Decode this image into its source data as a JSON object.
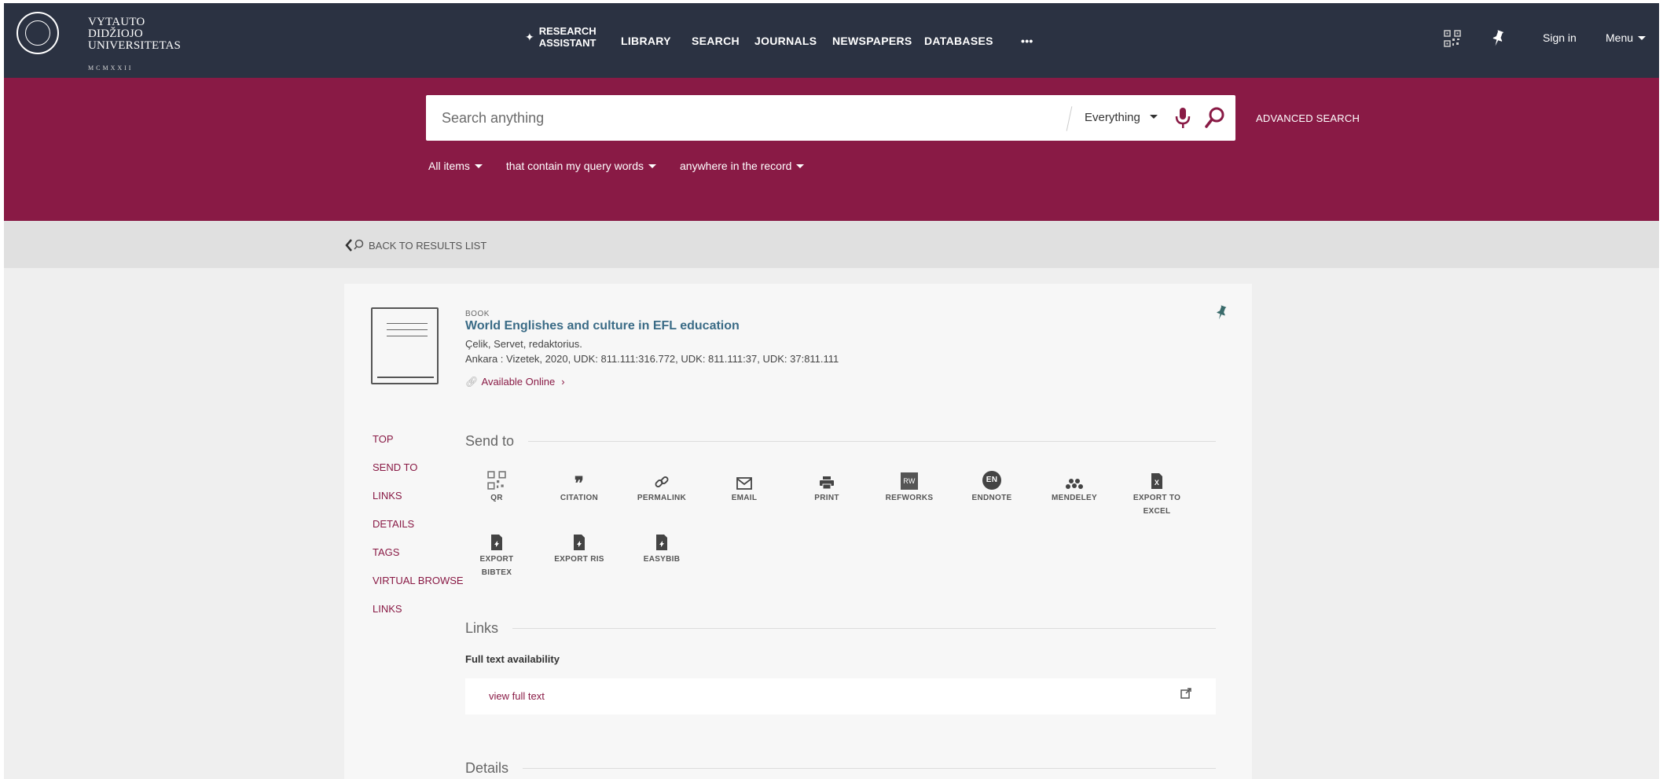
{
  "header": {
    "university_lines": [
      "VYTAUTO",
      "DIDŽIOJO",
      "UNIVERSITETAS"
    ],
    "founding_year": "MCMXXII",
    "research_assistant": [
      "RESEARCH",
      "ASSISTANT"
    ],
    "nav": [
      "LIBRARY",
      "SEARCH",
      "JOURNALS",
      "NEWSPAPERS",
      "DATABASES"
    ],
    "more": "•••",
    "sign_in": "Sign in",
    "menu": "Menu"
  },
  "search": {
    "placeholder": "Search anything",
    "scope": "Everything",
    "advanced": "ADVANCED SEARCH",
    "filters": [
      "All items",
      "that contain my query words",
      "anywhere in the record"
    ]
  },
  "back": {
    "label": "BACK TO RESULTS LIST"
  },
  "record": {
    "type": "BOOK",
    "title": "World Englishes and culture in EFL education",
    "author": "Çelik, Servet, redaktorius.",
    "publication": "Ankara : Vizetek, 2020, UDK: 811.111:316.772, UDK: 811.111:37, UDK: 37:811.111",
    "availability": "Available Online",
    "availability_arrow": "›"
  },
  "sidenav": [
    "TOP",
    "SEND TO",
    "LINKS",
    "DETAILS",
    "TAGS",
    "VIRTUAL BROWSE",
    "LINKS"
  ],
  "send_to": {
    "heading": "Send to",
    "actions": [
      {
        "label": "QR",
        "icon": "qr-icon"
      },
      {
        "label": "CITATION",
        "icon": "quote-icon"
      },
      {
        "label": "PERMALINK",
        "icon": "link-icon"
      },
      {
        "label": "EMAIL",
        "icon": "envelope-icon"
      },
      {
        "label": "PRINT",
        "icon": "printer-icon"
      },
      {
        "label": "REFWORKS",
        "icon": "refworks-icon",
        "badge": "RW"
      },
      {
        "label": "ENDNOTE",
        "icon": "endnote-icon",
        "badge": "EN"
      },
      {
        "label": "MENDELEY",
        "icon": "mendeley-icon"
      },
      {
        "label": "EXPORT TO\nEXCEL",
        "icon": "excel-icon"
      },
      {
        "label": "EXPORT\nBIBTEX",
        "icon": "bibtex-icon"
      },
      {
        "label": "EXPORT RIS",
        "icon": "ris-icon"
      },
      {
        "label": "EASYBIB",
        "icon": "easybib-icon"
      }
    ]
  },
  "links": {
    "heading": "Links",
    "full_text_label": "Full text availability",
    "view_full_text": "view full text"
  },
  "details": {
    "heading": "Details"
  },
  "colors": {
    "nav_bg": "#2b3242",
    "accent": "#891a45",
    "title": "#3a6b86"
  }
}
